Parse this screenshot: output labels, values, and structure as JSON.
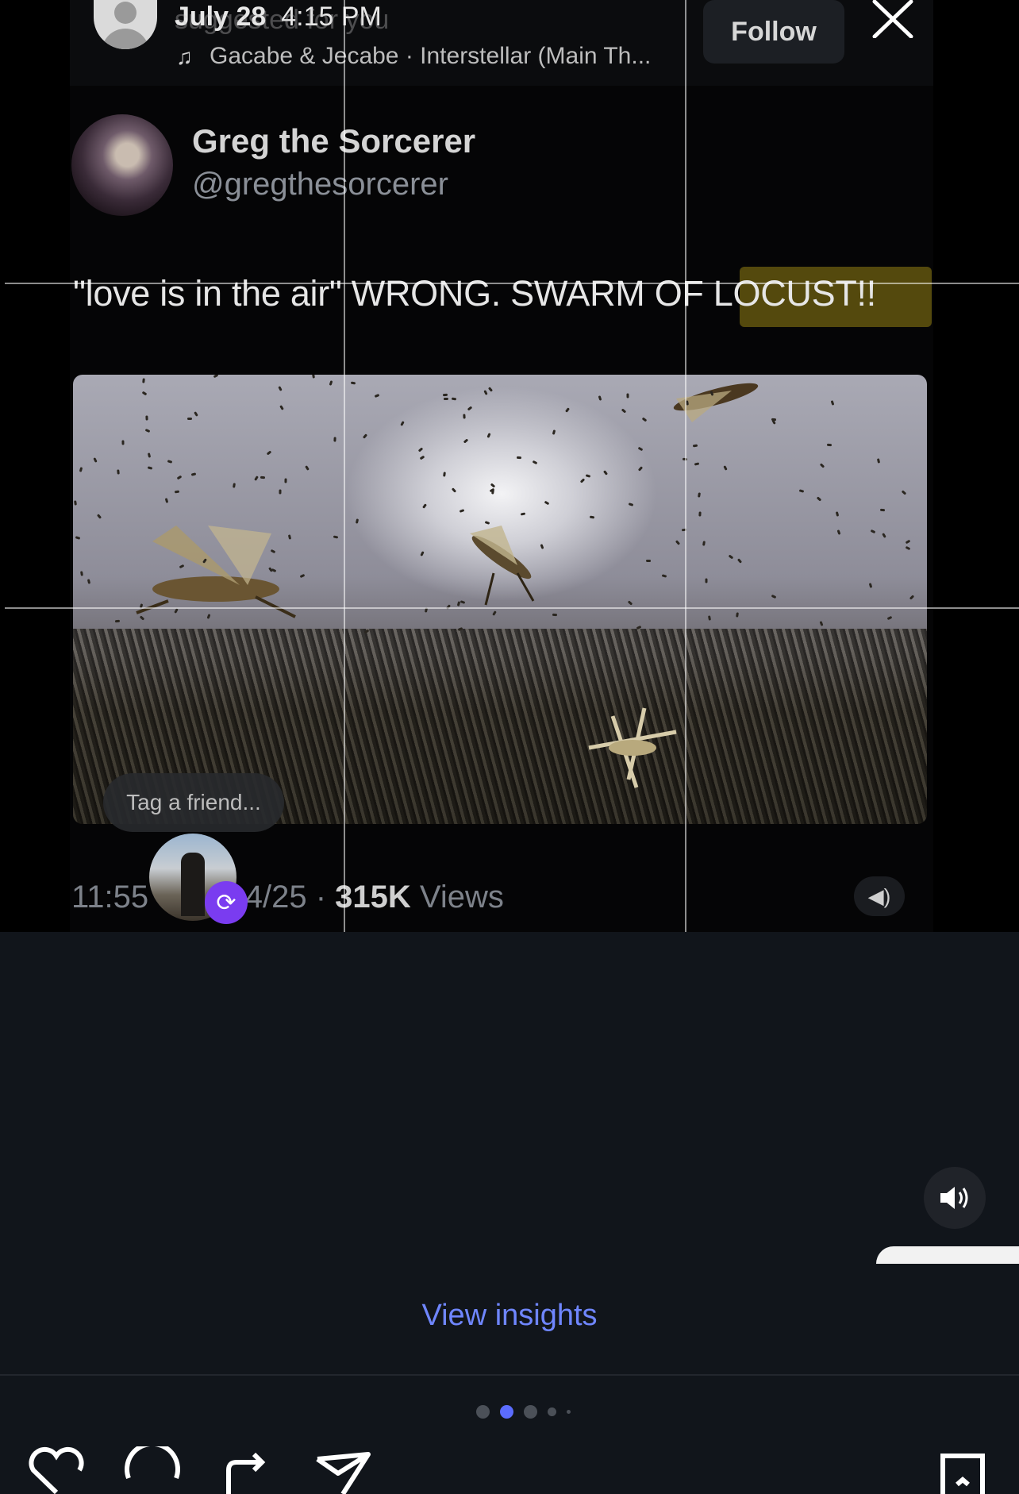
{
  "story": {
    "date_label": "July 28",
    "time_label": "4:15 PM",
    "ghost_label": "suggested for you",
    "music_text": "Gacabe & Jecabe · Interstellar (Main Th...",
    "follow_label": "Follow"
  },
  "tweet": {
    "author_name": "Greg the Sorcerer",
    "author_handle": "@gregthesorcerer",
    "text": "\"love is in the air\" WRONG. SWARM OF LOCUST!!",
    "tag_prompt": "Tag a friend...",
    "time_prefix": "11:55",
    "date_suffix": "/14/25 ·",
    "views_count": "315K",
    "views_label": "Views"
  },
  "footer": {
    "view_insights_label": "View insights",
    "page_indicator": {
      "count": 5,
      "active_index": 1
    }
  },
  "icons": {
    "owner_avatar": "default-avatar-icon",
    "music": "music-note-icon",
    "close": "close-icon",
    "sound": "speaker-icon",
    "repost": "repost-icon",
    "like": "heart-icon",
    "comment": "comment-icon",
    "share": "repost-share-icon",
    "send": "send-icon",
    "save": "bookmark-icon"
  },
  "colors": {
    "background": "#11151b",
    "accent_link": "#6f86ff",
    "active_dot": "#5b6cff",
    "highlight": "#8c7a14",
    "repost_badge": "#7a3cf0"
  }
}
